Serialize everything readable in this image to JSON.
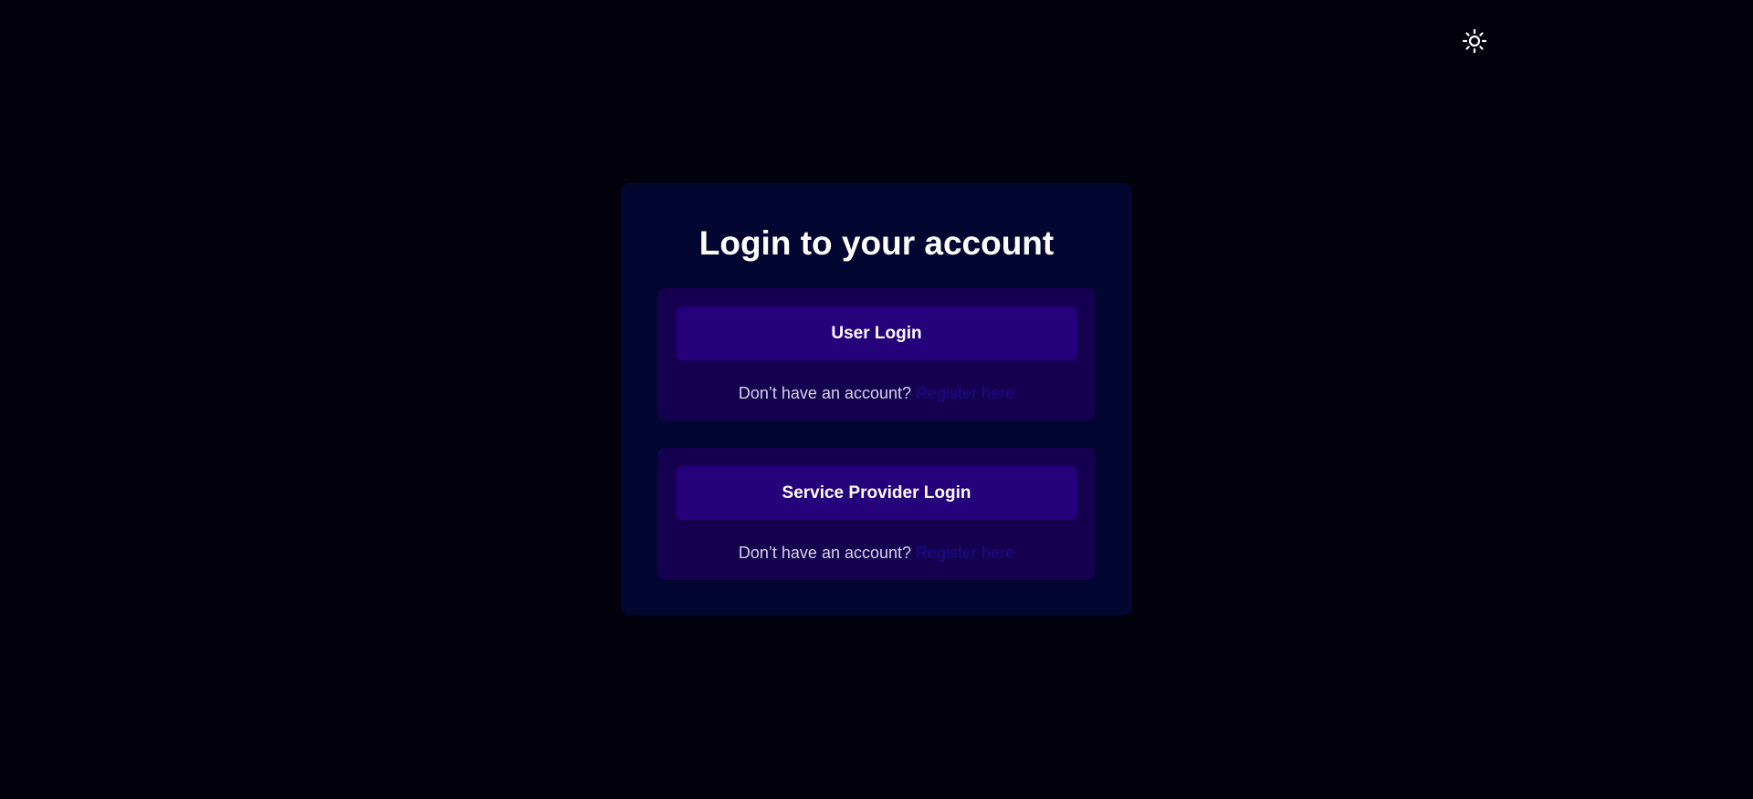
{
  "theme_toggle": {
    "icon": "sun-icon"
  },
  "login_card": {
    "title": "Login to your account",
    "user_section": {
      "button_label": "User Login",
      "prompt": "Don’t have an account?",
      "link_text": "Register here"
    },
    "provider_section": {
      "button_label": "Service Provider Login",
      "prompt": "Don’t have an account?",
      "link_text": "Register here"
    }
  },
  "colors": {
    "background": "#03020c",
    "card": "#020630",
    "panel": "#14004f",
    "button": "#24007b",
    "link": "#1d0a8c"
  }
}
